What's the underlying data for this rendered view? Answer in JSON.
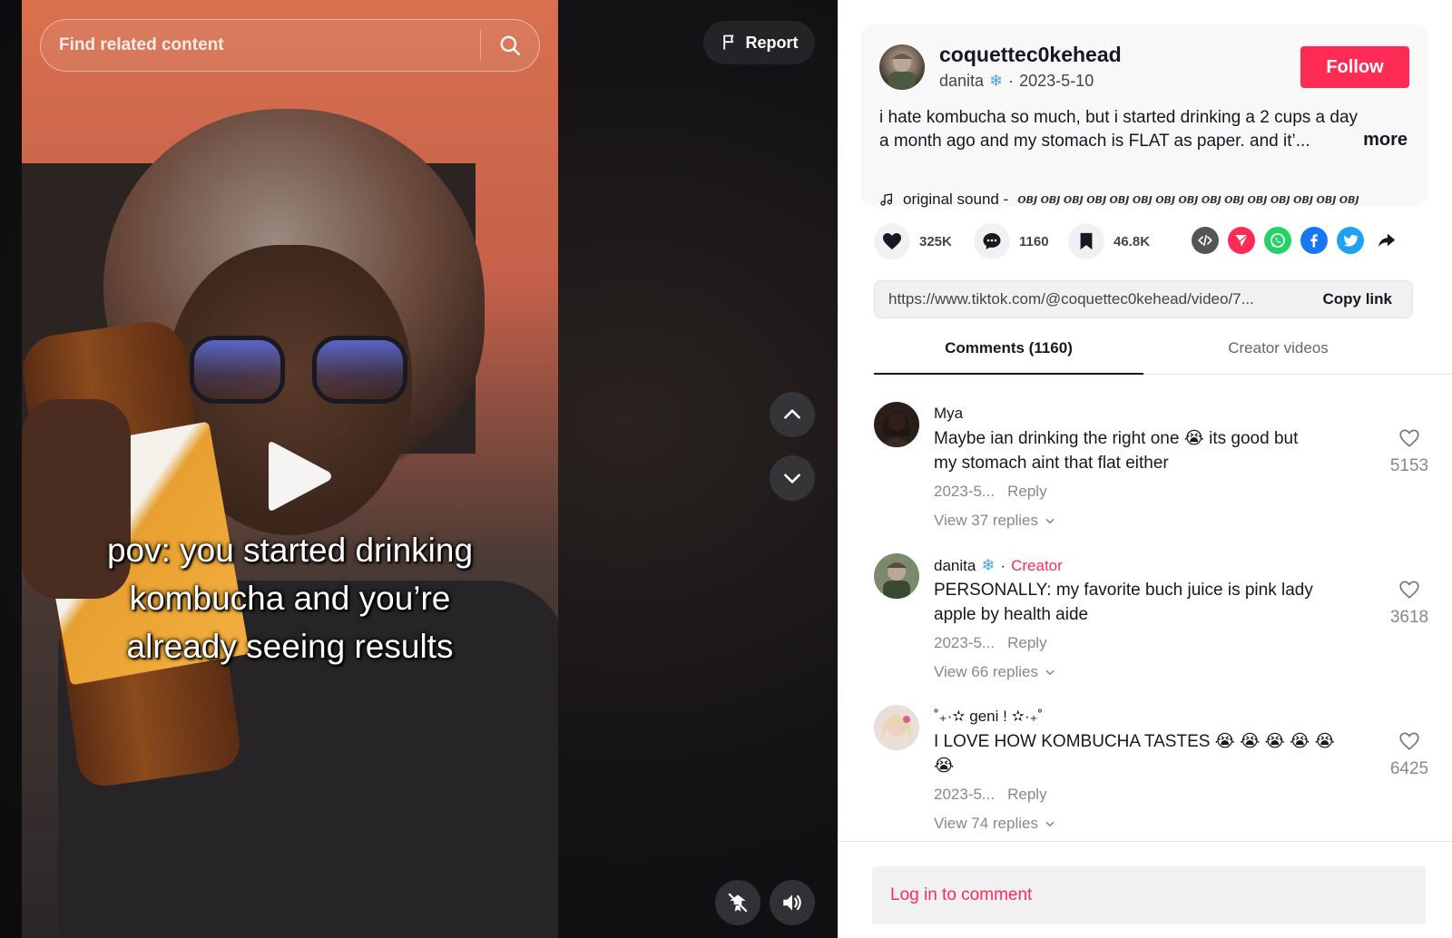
{
  "search": {
    "placeholder": "Find related content"
  },
  "report": {
    "label": "Report"
  },
  "video": {
    "caption_lines": [
      "pov: you started drinking",
      "kombucha and you’re",
      "already seeing results"
    ]
  },
  "author": {
    "username": "coquettec0kehead",
    "nickname": "danita",
    "date": "2023-5-10",
    "follow_label": "Follow"
  },
  "description": {
    "line1": "i hate kombucha so much, but i started drinking a 2 cups a day",
    "line2": "a month ago and my stomach is FLAT as paper. and it’...",
    "more_label": "more"
  },
  "sound": {
    "prefix": "original sound - ",
    "glyphs": "𝙊𝘽𝙅 𝙊𝘽𝙅 𝙊𝘽𝙅 𝙊𝘽𝙅 𝙊𝘽𝙅 𝙊𝘽𝙅 𝙊𝘽𝙅 𝙊𝘽𝙅 𝙊𝘽𝙅 𝙊𝘽𝙅 𝙊𝘽𝙅 𝙊𝘽𝙅 𝙊𝘽𝙅 𝙊𝘽𝙅 𝙊𝘽𝙅"
  },
  "stats": {
    "likes": "325K",
    "comments": "1160",
    "saves": "46.8K"
  },
  "share_icons": [
    "embed-icon",
    "send-icon",
    "whatsapp-icon",
    "facebook-icon",
    "twitter-icon",
    "share-arrow-icon"
  ],
  "link": {
    "url": "https://www.tiktok.com/@coquettec0kehead/video/7...",
    "copy_label": "Copy link"
  },
  "tabs": {
    "comments": "Comments (1160)",
    "creator_videos": "Creator videos"
  },
  "comments": [
    {
      "user": "Mya",
      "creator": "",
      "line1": "Maybe ian drinking the right one 😭 its good but",
      "line2": "my stomach aint that flat either",
      "date": "2023-5...",
      "reply": "Reply",
      "views": "View 37 replies",
      "likes": "5153"
    },
    {
      "user": "danita",
      "creator": "Creator",
      "line1": "PERSONALLY: my favorite buch juice is pink lady",
      "line2": "apple by health aide",
      "date": "2023-5...",
      "reply": "Reply",
      "views": "View 66 replies",
      "likes": "3618"
    },
    {
      "user": "˚₊·✫ geni ! ✫·₊˚",
      "creator": "",
      "line1": "I LOVE HOW KOMBUCHA TASTES 😭 😭 😭 😭 😭",
      "line2": "😭",
      "date": "2023-5...",
      "reply": "Reply",
      "views": "View 74 replies",
      "likes": "6425"
    }
  ],
  "login": {
    "label": "Log in to comment"
  },
  "colors": {
    "accent": "#fe2c55",
    "text": "#161823",
    "muted": "#888888"
  }
}
